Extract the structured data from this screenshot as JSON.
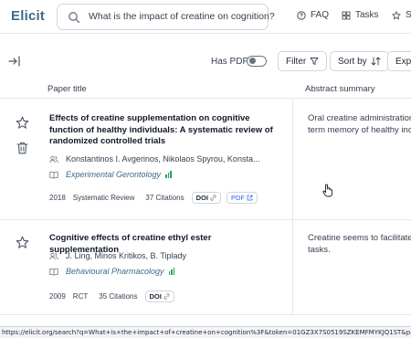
{
  "app": {
    "logo": "Elicit"
  },
  "search": {
    "query": "What is the impact of creatine on cognition?"
  },
  "nav": {
    "faq": "FAQ",
    "tasks": "Tasks",
    "truncated": "St"
  },
  "toolbar": {
    "has_pdf_label": "Has PDF",
    "has_pdf_on": false,
    "filter_label": "Filter",
    "sort_label": "Sort by",
    "export_label": "Expo"
  },
  "columns": {
    "title": "Paper title",
    "summary": "Abstract summary"
  },
  "papers": [
    {
      "title": "Effects of creatine supplementation on cognitive function of healthy individuals: A systematic review of randomized controlled trials",
      "authors": "Konstantinos I. Avgerinos, Nikolaos Spyrou, Konsta...",
      "journal": "Experimental Gerontology",
      "year": "2018",
      "type": "Systematic Review",
      "citations": "37 Citations",
      "doi": "DOI",
      "pdf": "PDF",
      "summary_line1": "Oral creatine administration",
      "summary_line2": "term memory of healthy indi"
    },
    {
      "title": "Cognitive effects of creatine ethyl ester supplementation",
      "authors": "J. Ling, Minos Kritikos, B. Tiplady",
      "journal": "Behavioural Pharmacology",
      "year": "2009",
      "type": "RCT",
      "citations": "35 Citations",
      "doi": "DOI",
      "summary_line1": "Creatine seems to facilitate",
      "summary_line2": "tasks."
    }
  ],
  "status_bar": {
    "url": "https://elicit.org/search?q=What+is+the+impact+of+creatine+on+cognition%3F&token=01GZ3X7S0519SZKEMFMYKJQ1ST&paper=deb4f9"
  },
  "colors": {
    "brand": "#3d6a89",
    "journal_bars": "#22a55b",
    "pdf_link": "#2563eb"
  }
}
